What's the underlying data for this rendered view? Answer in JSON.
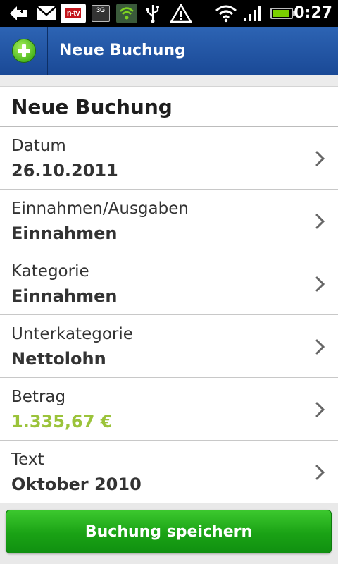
{
  "status_bar": {
    "time": "0:27",
    "icons": [
      "back-arrow-icon",
      "mail-icon",
      "ntv-app-icon",
      "3g-icon",
      "shield-icon",
      "usb-icon",
      "warning-icon",
      "wifi-icon",
      "signal-icon",
      "battery-icon"
    ],
    "ntv_label": "n-tv",
    "network_label": "3G",
    "battery_level": 0.9,
    "battery_color": "#7bd000"
  },
  "title_bar": {
    "title": "Neue Buchung",
    "icon": "add-circle-icon",
    "color": "#2559a8"
  },
  "form": {
    "heading": "Neue Buchung",
    "fields": [
      {
        "label": "Datum",
        "value": "26.10.2011"
      },
      {
        "label": "Einnahmen/Ausgaben",
        "value": "Einnahmen"
      },
      {
        "label": "Kategorie",
        "value": "Einnahmen"
      },
      {
        "label": "Unterkategorie",
        "value": "Nettolohn"
      },
      {
        "label": "Betrag",
        "value": "1.335,67 €"
      },
      {
        "label": "Text",
        "value": "Oktober 2010"
      }
    ],
    "amount_color": "#9bc33a"
  },
  "actions": {
    "save_label": "Buchung speichern",
    "save_color": "#1aa215"
  }
}
